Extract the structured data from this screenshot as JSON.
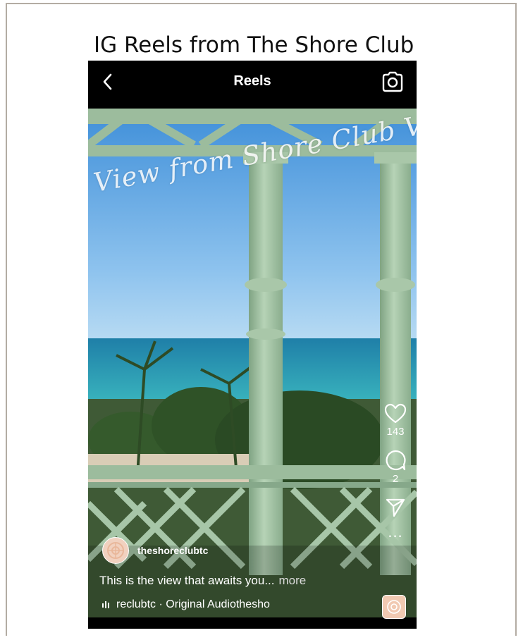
{
  "document": {
    "title": "IG Reels from The Shore Club"
  },
  "topbar": {
    "back_icon": "chevron-left-icon",
    "title": "Reels",
    "camera_icon": "camera-icon"
  },
  "reel": {
    "overlay_text": "View from Shore Club Villas",
    "author": {
      "username": "theshoreclubtc",
      "avatar_icon": "brand-logo-avatar"
    },
    "caption": {
      "text": "This is the view that awaits you...",
      "more": "more"
    },
    "audio": {
      "icon": "audio-bars-icon",
      "text": "reclubtc · Original Audiothesho"
    }
  },
  "actions": {
    "like": {
      "icon": "heart-icon",
      "count": "143"
    },
    "comment": {
      "icon": "comment-bubble-icon",
      "count": "2"
    },
    "share": {
      "icon": "send-icon"
    },
    "more": {
      "icon": "more-dots-icon",
      "label": "..."
    }
  },
  "colors": {
    "topbar_bg": "#000000",
    "sky": "#4f9fe0",
    "sea": "#2b9bb0",
    "railing": "#9cbc9d",
    "frame_border": "#b3aca3",
    "avatar_bg": "#f1d1bf"
  }
}
